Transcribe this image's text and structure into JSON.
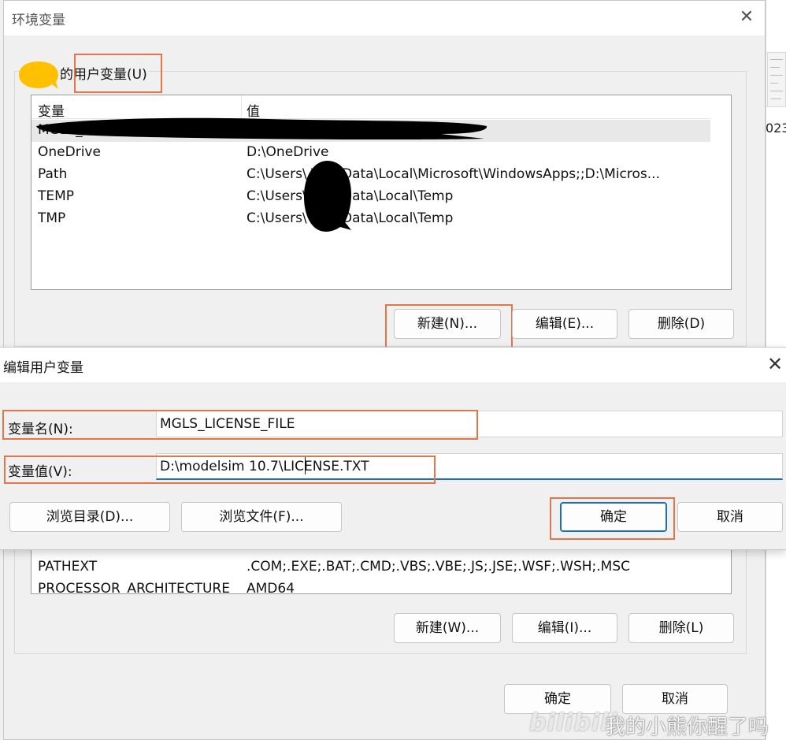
{
  "env_window": {
    "title": "环境变量",
    "close_glyph": "✕"
  },
  "user_vars": {
    "group_label": "的用户变量(U)",
    "col_variable": "变量",
    "col_value": "值",
    "rows": [
      {
        "name": "MGLS_",
        "value": ""
      },
      {
        "name": "OneDrive",
        "value": "D:\\OneDrive"
      },
      {
        "name": "Path",
        "value": "C:\\Users\\      \\AppData\\Local\\Microsoft\\WindowsApps;;D:\\Micros..."
      },
      {
        "name": "TEMP",
        "value": "C:\\Users\\      \\AppData\\Local\\Temp"
      },
      {
        "name": "TMP",
        "value": "C:\\Users\\      \\AppData\\Local\\Temp"
      }
    ],
    "btn_new": "新建(N)...",
    "btn_edit": "编辑(E)...",
    "btn_delete": "删除(D)"
  },
  "edit_dialog": {
    "title": "编辑用户变量",
    "close_glyph": "✕",
    "name_label": "变量名(N):",
    "name_value": "MGLS_LICENSE_FILE",
    "value_label": "变量值(V):",
    "value_value": "D:\\modelsim 10.7\\LICENSE.TXT",
    "btn_browse_dir": "浏览目录(D)...",
    "btn_browse_file": "浏览文件(F)...",
    "btn_ok": "确定",
    "btn_cancel": "取消"
  },
  "sys_vars": {
    "rows": [
      {
        "name": "PATHEXT",
        "value": ".COM;.EXE;.BAT;.CMD;.VBS;.VBE;.JS;.JSE;.WSF;.WSH;.MSC"
      },
      {
        "name": "PROCESSOR_ARCHITECTURE",
        "value": "AMD64"
      }
    ],
    "btn_new": "新建(W)...",
    "btn_edit": "编辑(I)...",
    "btn_delete": "删除(L)"
  },
  "footer": {
    "btn_ok": "确定",
    "btn_cancel": "取消"
  },
  "background": {
    "partial_text": "023"
  },
  "watermark": {
    "logo": "bilibili",
    "text": "我的小熊你醒了吗"
  },
  "colors": {
    "highlight": "#e0764a",
    "focus": "#1b6ec2",
    "bubble": "#ffc000",
    "redaction": "#000000"
  }
}
